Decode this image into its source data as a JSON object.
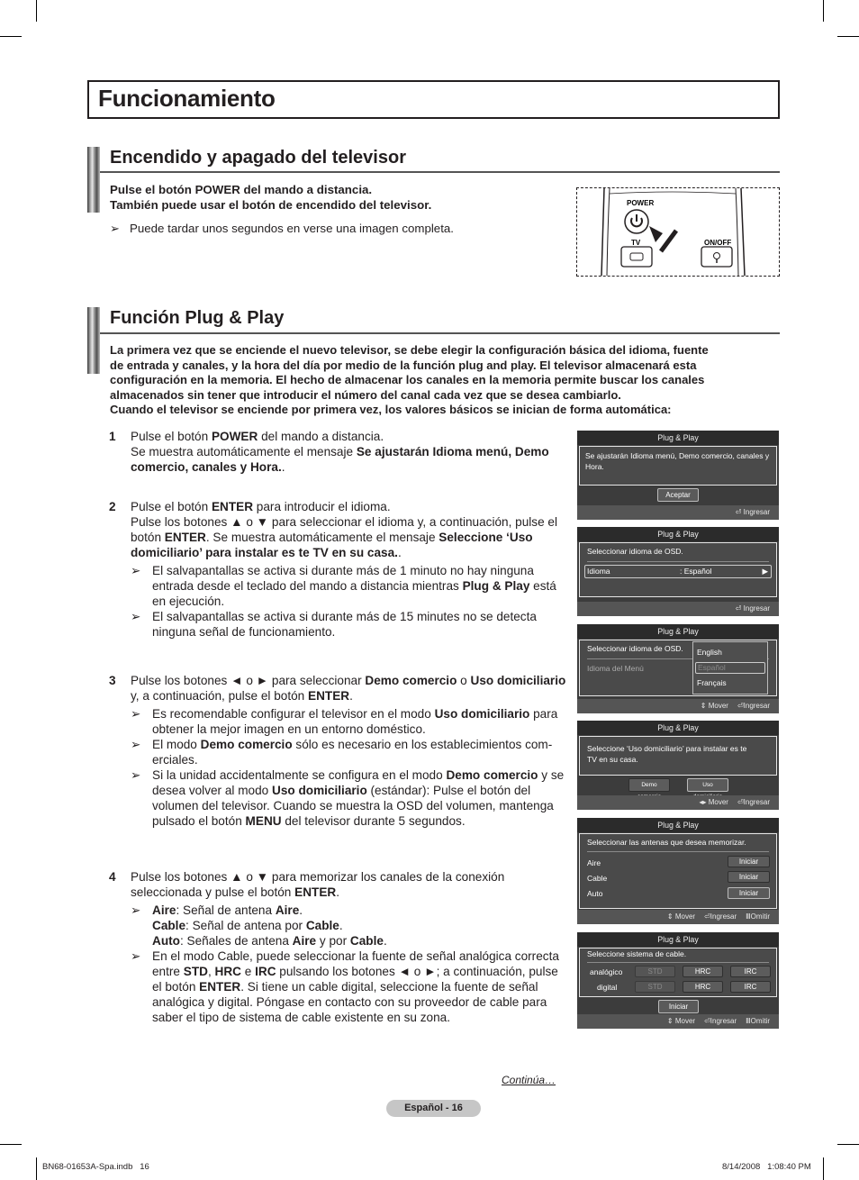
{
  "page": {
    "title": "Funcionamiento",
    "continues": "Continúa…",
    "page_label": "Español - 16",
    "footer_file": "BN68-01653A-Spa.indb   16",
    "footer_timestamp": "8/14/2008   1:08:40 PM"
  },
  "section1": {
    "heading": "Encendido y apagado del televisor",
    "line1": "Pulse el botón POWER del mando a distancia.",
    "line2": "También puede usar el botón de encendido del televisor.",
    "note": "Puede tardar unos segundos en verse una imagen completa.",
    "remote": {
      "power_label": "POWER",
      "tv_label": "TV",
      "onoff_label": "ON/OFF"
    }
  },
  "section2": {
    "heading": "Función Plug & Play",
    "intro": [
      "La primera vez que se enciende el nuevo televisor, se debe elegir la configuración básica del idioma, fuente",
      "de entrada y canales, y la hora del día por medio de la función plug and play. El televisor almacenará esta",
      "configuración en la memoria. El hecho de almacenar los canales en la memoria permite buscar los canales",
      "almacenados sin tener que introducir el número del canal cada vez que se desea cambiarlo.",
      "Cuando el televisor se enciende por primera vez, los valores básicos se inician de forma automática:"
    ],
    "steps": [
      {
        "num": "1",
        "p1": "Pulse el botón ",
        "b1": "POWER",
        "p2": " del mando a distancia.",
        "p3": "Se muestra automáticamente el mensaje ",
        "b2": "Se ajustarán Idioma menú, Demo comercio, canales y Hora.",
        "p4": "."
      },
      {
        "num": "2",
        "p1": "Pulse el botón ",
        "b1": "ENTER",
        "p2": " para introducir el idioma.",
        "p3": "Pulse los botones ▲ o ▼ para seleccionar el idioma y, a continuación, pulse el botón ",
        "b2": "ENTER",
        "p4": ". Se muestra automáticamente el mensaje ",
        "b3": "Seleccione ‘Uso domiciliario’ para instalar es te TV en su casa.",
        "p5": ".",
        "notes": [
          {
            "t1": "El salvapantallas se activa si durante más de 1 minuto no hay ninguna entrada desde el teclado del mando a distancia mientras ",
            "b1": "Plug & Play",
            "t2": " está en ejecución."
          },
          {
            "t1": "El salvapantallas se activa si durante más de 15 minutes no se detecta ninguna señal de funcionamiento."
          }
        ]
      },
      {
        "num": "3",
        "p1": "Pulse los botones ◄ o ► para seleccionar ",
        "b1": "Demo comercio",
        "p2": " o ",
        "b2": "Uso domiciliario",
        "p3": " y, a continuación, pulse el botón ",
        "b3": "ENTER",
        "p4": ".",
        "notes": [
          {
            "t1": "Es recomendable configurar el televisor en el modo ",
            "b1": "Uso domiciliario",
            "t2": " para obtener la mejor imagen en un entorno doméstico."
          },
          {
            "t1": "El modo ",
            "b1": "Demo comercio",
            "t2": " sólo es necesario en los establecimientos com-erciales."
          },
          {
            "t1": "Si la unidad accidentalmente se configura en el modo ",
            "b1": "Demo comercio",
            "t2": " y se desea volver al modo ",
            "b2": "Uso domiciliario",
            "t3": " (estándar): Pulse el botón del volumen del televisor. Cuando se muestra la OSD del volumen, mantenga pulsado el botón ",
            "b3": "MENU",
            "t4": " del televisor durante 5 segundos."
          }
        ]
      },
      {
        "num": "4",
        "p1": "Pulse los botones ▲ o ▼ para memorizar los canales de la conexión seleccionada y pulse el botón ",
        "b1": "ENTER",
        "p2": ".",
        "notes": [
          {
            "aire_b": "Aire",
            "aire_t": ": Señal de antena ",
            "aire_b2": "Aire",
            "aire_e": ".",
            "cable_b": "Cable",
            "cable_t": ": Señal de antena por ",
            "cable_b2": "Cable",
            "cable_e": ".",
            "auto_b": "Auto",
            "auto_t": ": Señales de antena ",
            "auto_b2": "Aire",
            "auto_m": " y por ",
            "auto_b3": "Cable",
            "auto_e": "."
          },
          {
            "t1": "En el modo Cable, puede seleccionar la fuente de señal analógica correcta entre ",
            "b1": "STD",
            "t2": ", ",
            "b2": "HRC",
            "t3": " e ",
            "b3": "IRC",
            "t4": " pulsando los botones ◄ o ►; a continuación, pulse el botón ",
            "b4": "ENTER",
            "t5": ". Si tiene un cable digital, seleccione la fuente de señal analógica y digital. Póngase en contacto con su proveedor de cable para saber el tipo de sistema de cable existente en su zona."
          }
        ]
      }
    ]
  },
  "osd": {
    "header": "Plug & Play",
    "s1": {
      "message": "Se ajustarán Idioma menú, Demo comercio, canales y Hora.",
      "button": "Aceptar",
      "foot_enter": "Ingresar"
    },
    "s2": {
      "message": "Seleccionar idioma de OSD.",
      "label": "Idioma",
      "value": ": Español",
      "foot_enter": "Ingresar"
    },
    "s3": {
      "message": "Seleccionar idioma de OSD.",
      "label": "Idioma del Menú",
      "options": [
        "English",
        "Español",
        "Français"
      ],
      "selected": "Español",
      "foot_move": "Mover",
      "foot_enter": "Ingresar"
    },
    "s4": {
      "message": "Seleccione ‘Uso domiciliario’ para instalar es te TV en su casa.",
      "btn_demo": "Demo comercio",
      "btn_home": "Uso domiciliario",
      "foot_move": "Mover",
      "foot_enter": "Ingresar"
    },
    "s5": {
      "message": "Seleccionar las antenas que desea memorizar.",
      "rows": [
        {
          "label": "Aire",
          "btn": "Iniciar"
        },
        {
          "label": "Cable",
          "btn": "Iniciar"
        },
        {
          "label": "Auto",
          "btn": "Iniciar"
        }
      ],
      "foot_move": "Mover",
      "foot_enter": "Ingresar",
      "foot_skip": "Omitir"
    },
    "s6": {
      "message": "Seleccione sistema de cable.",
      "rows": [
        {
          "label": "analógico",
          "opts": [
            "STD",
            "HRC",
            "IRC"
          ]
        },
        {
          "label": "digital",
          "opts": [
            "STD",
            "HRC",
            "IRC"
          ]
        }
      ],
      "button": "Iniciar",
      "foot_move": "Mover",
      "foot_enter": "Ingresar",
      "foot_skip": "Omitir"
    }
  }
}
